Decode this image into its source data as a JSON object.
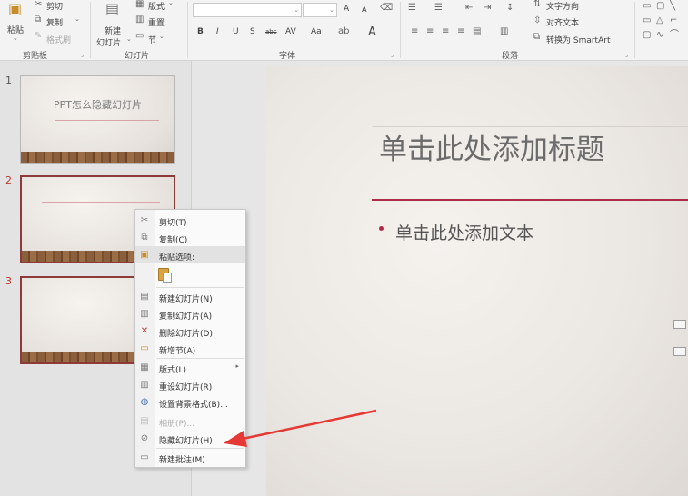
{
  "ribbon": {
    "clipboard": {
      "paste": "粘贴",
      "cut": "剪切",
      "copy": "复制",
      "format_painter": "格式刷",
      "group_label": "剪贴板"
    },
    "slides": {
      "new_slide_line1": "新建",
      "new_slide_line2": "幻灯片",
      "layout": "版式",
      "reset": "重置",
      "section": "节",
      "group_label": "幻灯片"
    },
    "font": {
      "grow": "A",
      "shrink": "A",
      "bold": "B",
      "italic": "I",
      "underline": "U",
      "strikethrough": "S",
      "abc": "abc",
      "spacing": "AV",
      "case": "Aa",
      "font_color": "A",
      "group_label": "字体"
    },
    "paragraph": {
      "text_direction": "文字方向",
      "align_text": "对齐文本",
      "smartart": "转换为 SmartArt",
      "group_label": "段落"
    }
  },
  "thumbnails": [
    {
      "number": "1",
      "title": "PPT怎么隐藏幻灯片"
    },
    {
      "number": "2",
      "title": ""
    },
    {
      "number": "3",
      "title": ""
    }
  ],
  "slide": {
    "title_placeholder": "单击此处添加标题",
    "body_placeholder": "单击此处添加文本"
  },
  "context_menu": {
    "items": [
      {
        "label": "剪切(T)",
        "icon": "scissors-icon",
        "enabled": true
      },
      {
        "label": "复制(C)",
        "icon": "copy-icon",
        "enabled": true
      },
      {
        "label": "粘贴选项:",
        "icon": "paste-icon",
        "enabled": true
      },
      {
        "label": "新建幻灯片(N)",
        "icon": "new-slide-icon",
        "enabled": true
      },
      {
        "label": "复制幻灯片(A)",
        "icon": "duplicate-slide-icon",
        "enabled": true
      },
      {
        "label": "删除幻灯片(D)",
        "icon": "delete-slide-icon",
        "enabled": true
      },
      {
        "label": "新增节(A)",
        "icon": "add-section-icon",
        "enabled": true
      },
      {
        "label": "版式(L)",
        "icon": "layout-icon",
        "enabled": true,
        "submenu": true
      },
      {
        "label": "重设幻灯片(R)",
        "icon": "reset-slide-icon",
        "enabled": true
      },
      {
        "label": "设置背景格式(B)...",
        "icon": "format-background-icon",
        "enabled": true
      },
      {
        "label": "相册(P)...",
        "icon": "photo-album-icon",
        "enabled": false
      },
      {
        "label": "隐藏幻灯片(H)",
        "icon": "hide-slide-icon",
        "enabled": true
      },
      {
        "label": "新建批注(M)",
        "icon": "new-comment-icon",
        "enabled": true
      }
    ]
  },
  "colors": {
    "accent": "#b02a48",
    "annotation_arrow": "#e53935",
    "selected_border": "#8e3a3a"
  }
}
